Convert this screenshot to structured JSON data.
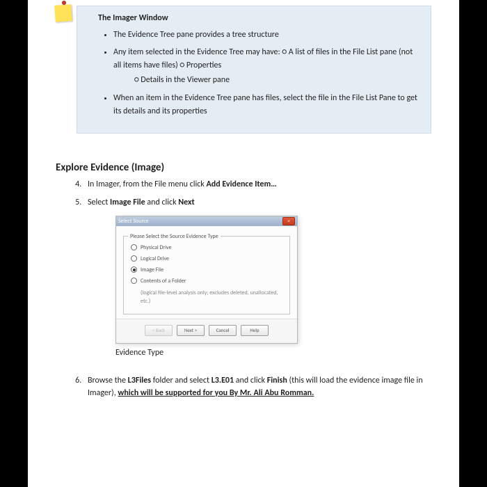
{
  "note": {
    "title": "The Imager Window",
    "bullets": {
      "b1": "The Evidence Tree pane provides a tree structure",
      "b2": "Any item selected in the Evidence Tree may have: ○ A list of files in the File List pane (not all items have files) ○ Properties",
      "b2_sub": "○ Details in the Viewer pane",
      "b3": "When an item in the Evidence Tree pane has files, select the file in the File List Pane to get its details and its properties"
    }
  },
  "section_title": "Explore Evidence (Image)",
  "steps": {
    "s4_pre": "In Imager, from the File menu click ",
    "s4_bold": "Add Evidence Item…",
    "s5_a": "Select ",
    "s5_b": "Image File",
    "s5_c": " and click ",
    "s5_d": "Next",
    "s6_a": "Browse the ",
    "s6_b": "L3Files",
    "s6_c": " folder and select ",
    "s6_d": "L3.E01",
    "s6_e": " and click ",
    "s6_f": "Finish",
    "s6_g": " (this will load the evidence image file in Imager), ",
    "s6_h": "which will be supported for you By Mr. Ali Abu Romman."
  },
  "dialog": {
    "title": "Select Source",
    "group_label": "Please Select the Source Evidence Type",
    "opt1": "Physical Drive",
    "opt2": "Logical Drive",
    "opt3": "Image File",
    "opt4": "Contents of a Folder",
    "opt4_sub": "(logical file-level analysis only; excludes deleted, unallocated, etc.)",
    "btn_back": "< Back",
    "btn_next": "Next >",
    "btn_cancel": "Cancel",
    "btn_help": "Help"
  },
  "dialog_caption": "Evidence Type"
}
